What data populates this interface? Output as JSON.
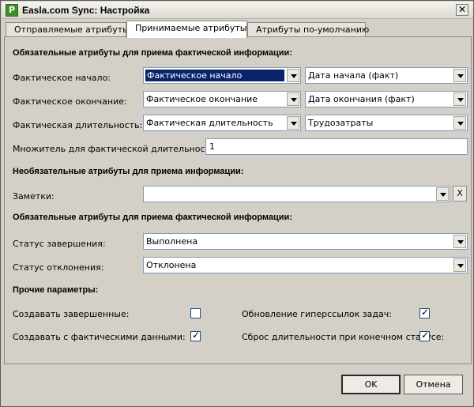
{
  "window": {
    "title": "Easla.com Sync: Настройка",
    "icon_letter": "P",
    "close": "✕"
  },
  "tabs": [
    {
      "label": "Отправляемые атрибуты"
    },
    {
      "label": "Принимаемые атрибуты"
    },
    {
      "label": "Атрибуты по-умолчанию"
    }
  ],
  "required_fact": {
    "heading": "Обязательные атрибуты для приема фактической информации:",
    "rows": [
      {
        "label": "Фактическое начало:",
        "source": "Фактическое начало",
        "target": "Дата начала (факт)"
      },
      {
        "label": "Фактическое окончание:",
        "source": "Фактическое окончание",
        "target": "Дата окончания (факт)"
      },
      {
        "label": "Фактическая длительность:",
        "source": "Фактическая длительность",
        "target": "Трудозатраты"
      }
    ],
    "multiplier_label": "Множитель для фактической длительности:",
    "multiplier_value": "1"
  },
  "optional": {
    "heading": "Необязательные атрибуты для приема информации:",
    "notes_label": "Заметки:",
    "notes_value": "",
    "clear_label": "X"
  },
  "required_status": {
    "heading": "Обязательные атрибуты для приема фактической информации:",
    "completion_label": "Статус завершения:",
    "completion_value": "Выполнена",
    "rejection_label": "Статус отклонения:",
    "rejection_value": "Отклонена"
  },
  "other": {
    "heading": "Прочие параметры:",
    "create_completed_label": "Создавать завершенные:",
    "create_completed_checked": false,
    "create_with_actuals_label": "Создавать с фактическими данными:",
    "create_with_actuals_checked": true,
    "update_hyperlinks_label": "Обновление гиперссылок задач:",
    "update_hyperlinks_checked": true,
    "reset_duration_label": "Сброс длительности при конечном статусе:",
    "reset_duration_checked": true
  },
  "footer": {
    "ok": "OK",
    "cancel": "Отмена"
  }
}
